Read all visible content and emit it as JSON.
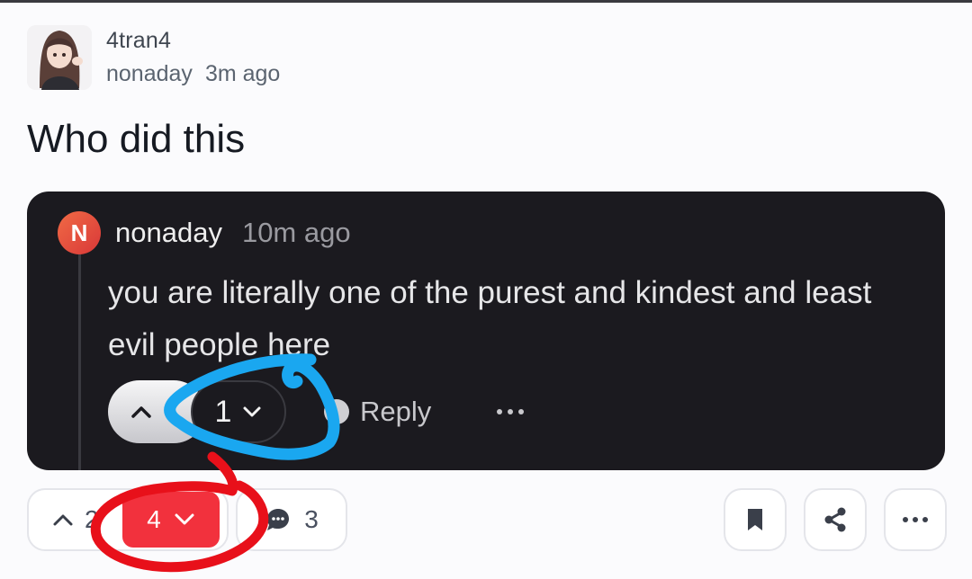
{
  "post": {
    "author": "4tran4",
    "community": "nonaday",
    "time": "3m ago",
    "title": "Who did this"
  },
  "embedded_comment": {
    "avatar_letter": "N",
    "author": "nonaday",
    "time": "10m ago",
    "body": "you are literally one of the purest and kindest and least evil people here",
    "vote_count": "1",
    "reply_label": "Reply",
    "more_label": "···"
  },
  "actions": {
    "score": "2",
    "downvotes": "4",
    "comments": "3"
  },
  "colors": {
    "downvote_badge": "#f2313d",
    "embed_background": "#1b1a1f",
    "blue_annotation": "#1aa7f0",
    "red_annotation": "#e8101a"
  },
  "icons": [
    "upvote-chevron-icon",
    "downvote-chevron-icon",
    "comment-bubble-icon",
    "bookmark-icon",
    "share-icon",
    "more-icon"
  ]
}
